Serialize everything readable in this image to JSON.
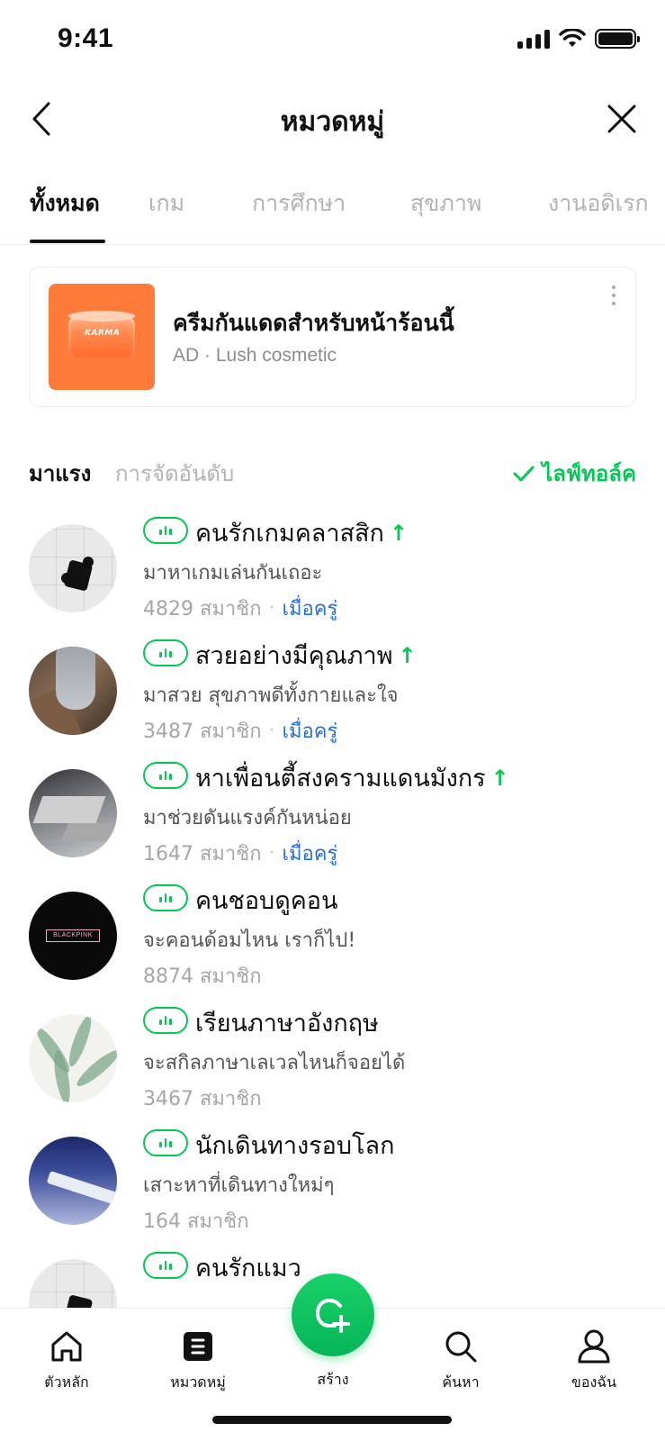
{
  "status": {
    "time": "9:41"
  },
  "header": {
    "title": "หมวดหมู่"
  },
  "tabs": [
    {
      "label": "ทั้งหมด"
    },
    {
      "label": "เกม"
    },
    {
      "label": "การศึกษา"
    },
    {
      "label": "สุขภาพ"
    },
    {
      "label": "งานอดิเรก"
    }
  ],
  "ad": {
    "title": "ครีมกันแดดสำหรับหน้าร้อนนี้",
    "meta": "AD · Lush cosmetic",
    "thumb_label": "KARMA"
  },
  "filters": {
    "active": "มาแรง",
    "inactive": "การจัดอันดับ",
    "live": "ไลฟ์ทอล์ค"
  },
  "trend_symbol": "↑",
  "recent_label": "เมื่อครู่",
  "items": [
    {
      "title": "คนรักเกมคลาสสิก",
      "desc": "มาหาเกมเล่นกันเถอะ",
      "members": "4829 สมาชิก"
    },
    {
      "title": "สวยอย่างมีคุณภาพ",
      "desc": "มาสวย สุขภาพดีทั้งกายและใจ",
      "members": "3487 สมาชิก"
    },
    {
      "title": "หาเพื่อนตี้สงครามแดนมังกร",
      "desc": "มาช่วยดันแรงค์กันหน่อย",
      "members": "1647 สมาชิก"
    },
    {
      "title": "คนชอบดูคอน",
      "desc": "จะคอนด้อมไหน เราก็ไป!",
      "members": "8874 สมาชิก",
      "avatar_text": "BLACKPINK"
    },
    {
      "title": "เรียนภาษาอังกฤษ",
      "desc": "จะสกิลภาษาเลเวลไหนก็จอยได้",
      "members": "3467 สมาชิก"
    },
    {
      "title": "นักเดินทางรอบโลก",
      "desc": "เสาะหาที่เดินทางใหม่ๆ",
      "members": "164 สมาชิก"
    },
    {
      "title": "คนรักแมว"
    }
  ],
  "bottom_nav": {
    "home": "ตัวหลัก",
    "category": "หมวดหมู่",
    "create": "สร้าง",
    "search": "ค้นหา",
    "mine": "ของฉัน"
  },
  "colors": {
    "accent": "#06c755",
    "link": "#2a6fe0",
    "ad_bg": "#ff7b3a"
  }
}
